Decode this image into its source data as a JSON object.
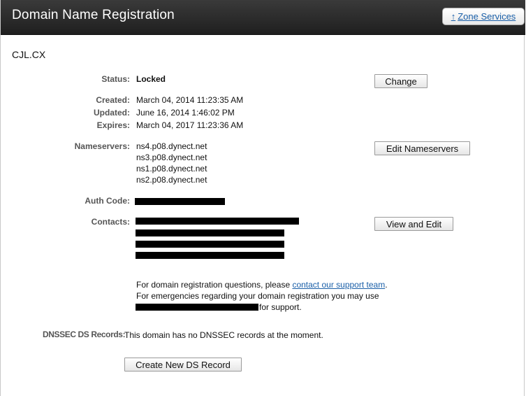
{
  "header": {
    "title": "Domain Name Registration",
    "zone_services_label": "Zone Services",
    "zone_services_icon": "up-arrow-icon"
  },
  "domain": "CJL.CX",
  "status": {
    "label": "Status:",
    "value": "Locked",
    "button": "Change"
  },
  "dates": {
    "created_label": "Created:",
    "created": "March 04, 2014 11:23:35 AM",
    "updated_label": "Updated:",
    "updated": "June 16, 2014 1:46:02 PM",
    "expires_label": "Expires:",
    "expires": "March 04, 2017 11:23:36 AM"
  },
  "nameservers": {
    "label": "Nameservers:",
    "items": [
      "ns4.p08.dynect.net",
      "ns3.p08.dynect.net",
      "ns1.p08.dynect.net",
      "ns2.p08.dynect.net"
    ],
    "button": "Edit Nameservers"
  },
  "auth": {
    "label": "Auth Code:"
  },
  "contacts": {
    "label": "Contacts:",
    "button": "View and Edit"
  },
  "support": {
    "line1_prefix": "For domain registration questions, please ",
    "line1_link": "contact our support team",
    "line1_suffix": ".",
    "line2": "For emergencies regarding your domain registration you may use",
    "line3_suffix": " for support."
  },
  "dnssec": {
    "label": "DNSSEC DS Records:",
    "message": "This domain has no DNSSEC records at the moment.",
    "button": "Create New DS Record"
  },
  "colors": {
    "header_bg": "#262626",
    "link": "#1a5fa8",
    "label": "#555555"
  }
}
